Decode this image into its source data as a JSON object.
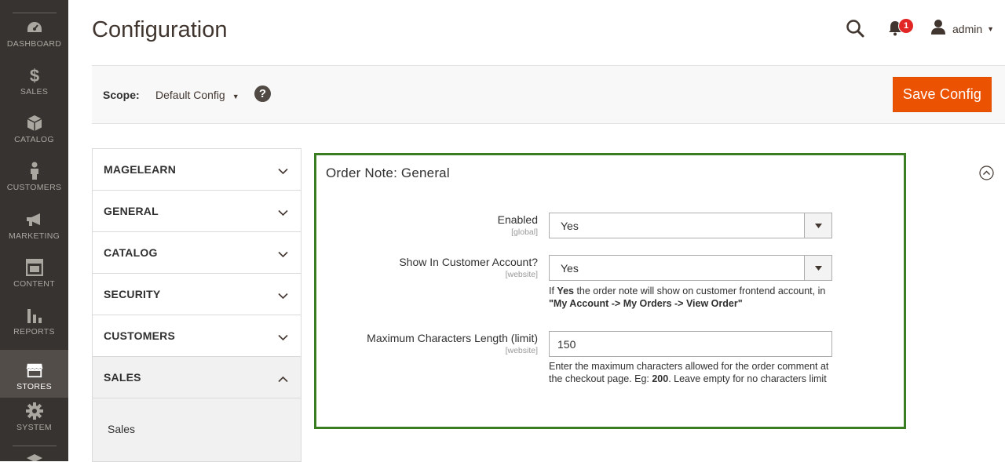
{
  "sidebar": {
    "items": [
      {
        "label": "DASHBOARD",
        "icon": "dashboard-icon"
      },
      {
        "label": "SALES",
        "icon": "dollar-icon"
      },
      {
        "label": "CATALOG",
        "icon": "box-icon"
      },
      {
        "label": "CUSTOMERS",
        "icon": "person-icon"
      },
      {
        "label": "MARKETING",
        "icon": "megaphone-icon"
      },
      {
        "label": "CONTENT",
        "icon": "content-layout-icon"
      },
      {
        "label": "REPORTS",
        "icon": "bar-chart-icon"
      },
      {
        "label": "STORES",
        "icon": "storefront-icon",
        "active": true
      },
      {
        "label": "SYSTEM",
        "icon": "gear-icon"
      }
    ]
  },
  "header": {
    "title": "Configuration",
    "notification_count": "1",
    "user_name": "admin"
  },
  "scope": {
    "label": "Scope:",
    "value": "Default Config",
    "help": "?"
  },
  "toolbar": {
    "save_label": "Save Config"
  },
  "tabs": [
    {
      "label": "MAGELEARN",
      "open": false
    },
    {
      "label": "GENERAL",
      "open": false
    },
    {
      "label": "CATALOG",
      "open": false
    },
    {
      "label": "SECURITY",
      "open": false
    },
    {
      "label": "CUSTOMERS",
      "open": false
    },
    {
      "label": "SALES",
      "open": true,
      "items": [
        "Sales"
      ]
    }
  ],
  "section": {
    "title": "Order Note: General",
    "fields": {
      "enabled": {
        "label": "Enabled",
        "scope": "[global]",
        "value": "Yes"
      },
      "show_in_account": {
        "label": "Show In Customer Account?",
        "scope": "[website]",
        "value": "Yes",
        "note_pre": "If ",
        "note_bold": "Yes",
        "note_post": " the order note will show on customer frontend account, in",
        "note_path": "\"My Account -> My Orders -> View Order\""
      },
      "max_length": {
        "label": "Maximum Characters Length (limit)",
        "scope": "[website]",
        "value": "150",
        "note_pre": "Enter the maximum characters allowed for the order comment at the checkout page. Eg: ",
        "note_bold": "200",
        "note_post": ". Leave empty for no characters limit"
      }
    }
  },
  "colors": {
    "sidebar_bg": "#373330",
    "sidebar_active": "#524d49",
    "accent": "#eb5202",
    "section_border": "#3a7d22",
    "badge": "#e22626"
  }
}
